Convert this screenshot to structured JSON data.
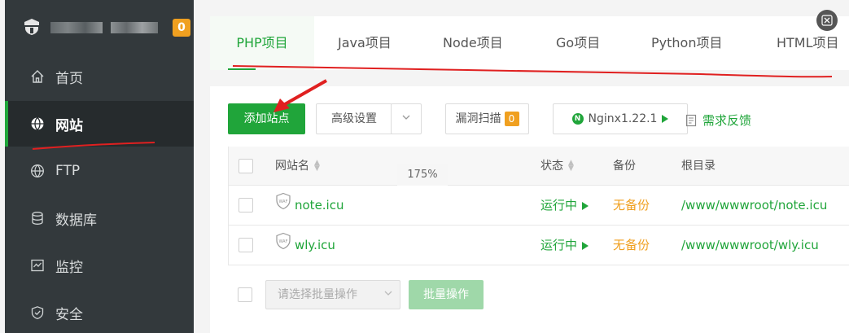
{
  "sidebar": {
    "notification_count": "0",
    "items": [
      {
        "label": "首页",
        "icon": "home-icon"
      },
      {
        "label": "网站",
        "icon": "globe-icon"
      },
      {
        "label": "FTP",
        "icon": "ftp-icon"
      },
      {
        "label": "数据库",
        "icon": "database-icon"
      },
      {
        "label": "监控",
        "icon": "monitor-icon"
      },
      {
        "label": "安全",
        "icon": "shield-icon"
      }
    ]
  },
  "tabs": [
    "PHP项目",
    "Java项目",
    "Node项目",
    "Go项目",
    "Python项目",
    "HTML项目"
  ],
  "toolbar": {
    "add_site": "添加站点",
    "advanced_settings": "高级设置",
    "vuln_scan": "漏洞扫描",
    "vuln_count": "0",
    "nginx_version": "Nginx1.22.1",
    "nginx_letter": "N",
    "feedback": "需求反馈"
  },
  "zoom_tip": "175%",
  "table": {
    "columns": {
      "site_name": "网站名",
      "status": "状态",
      "backup": "备份",
      "root": "根目录"
    },
    "rows": [
      {
        "name": "note.icu",
        "status": "运行中",
        "backup": "无备份",
        "root": "/www/wwwroot/note.icu"
      },
      {
        "name": "wly.icu",
        "status": "运行中",
        "backup": "无备份",
        "root": "/www/wwwroot/wly.icu"
      }
    ]
  },
  "bulk": {
    "select_placeholder": "请选择批量操作",
    "button": "批量操作"
  },
  "colors": {
    "accent": "#20a53a",
    "sidebar_bg": "#33393c",
    "badge": "#f0a020",
    "annotation": "#e02020"
  }
}
